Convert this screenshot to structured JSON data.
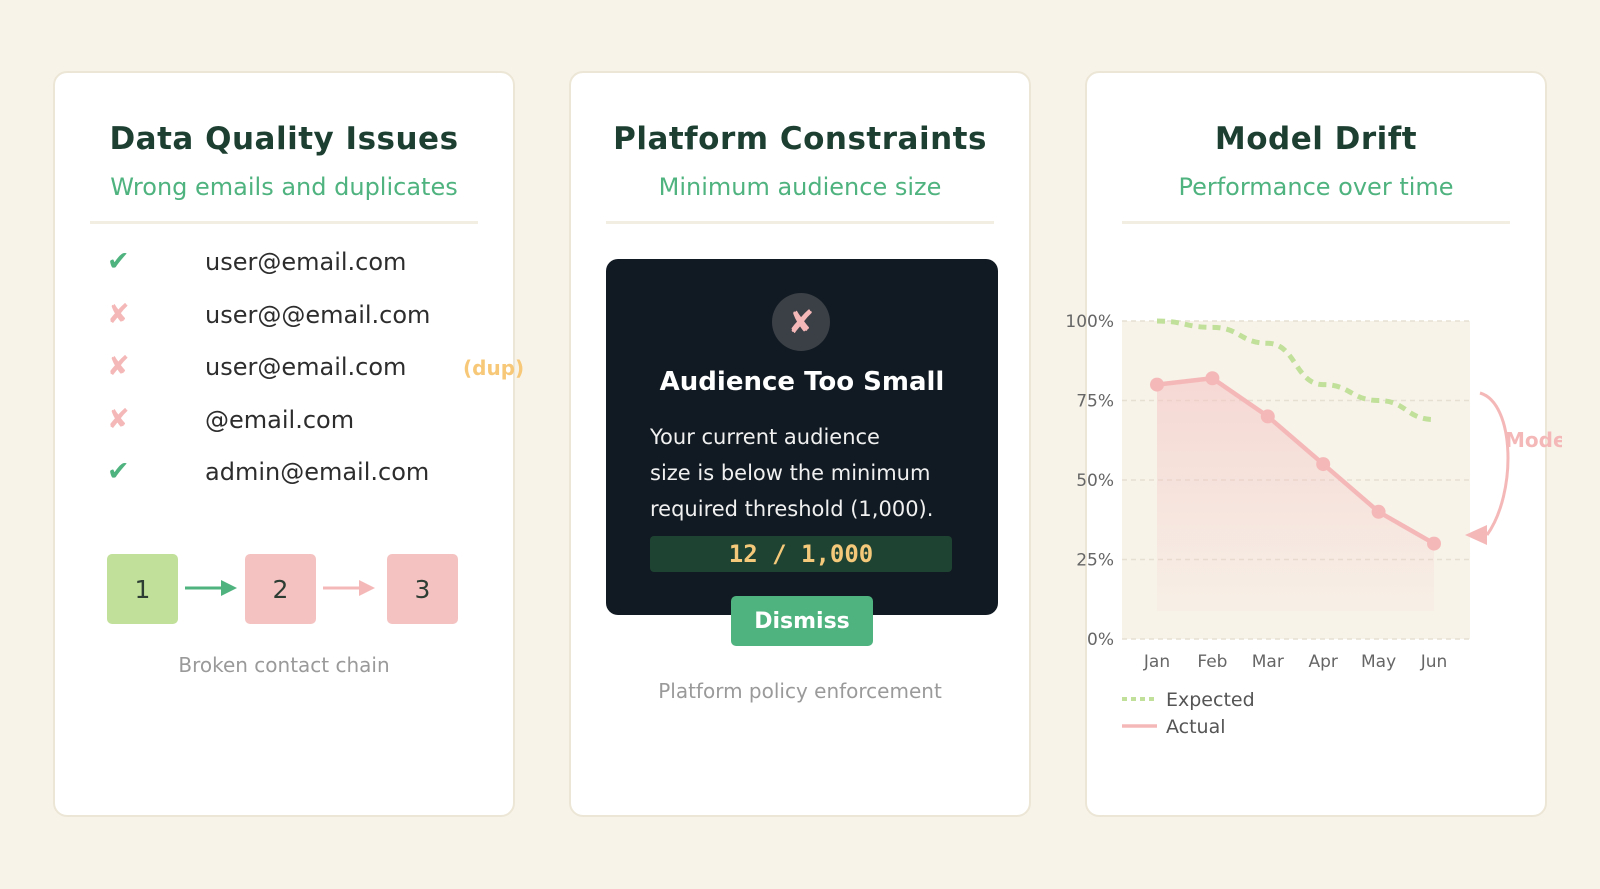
{
  "colors": {
    "background": "#f7f3e9",
    "title": "#1c3f32",
    "accent_green": "#4fb37f",
    "error_pink": "#f5b8b8",
    "light_green": "#c1e09a",
    "warning_amber": "#f7c878",
    "dialog_bg": "#111a22"
  },
  "data_quality": {
    "title": "Data Quality Issues",
    "subtitle": "Wrong emails and duplicates",
    "emails": [
      {
        "status_icon": "check-icon",
        "mark": "✔",
        "valid": true,
        "address": "user@email.com",
        "tag": ""
      },
      {
        "status_icon": "cross-icon",
        "mark": "✘",
        "valid": false,
        "address": "user@@email.com",
        "tag": ""
      },
      {
        "status_icon": "cross-icon",
        "mark": "✘",
        "valid": false,
        "address": "user@email.com",
        "tag": "(dup)"
      },
      {
        "status_icon": "cross-icon",
        "mark": "✘",
        "valid": false,
        "address": "@email.com",
        "tag": ""
      },
      {
        "status_icon": "check-icon",
        "mark": "✔",
        "valid": true,
        "address": "admin@email.com",
        "tag": ""
      }
    ],
    "chain": {
      "steps": [
        "1",
        "2",
        "3"
      ],
      "step_colors": [
        "#c1e09a",
        "#f5c2c2",
        "#f5c2c2"
      ],
      "caption": "Broken contact chain"
    }
  },
  "platform": {
    "title": "Platform Constraints",
    "subtitle": "Minimum audience size",
    "dialog": {
      "icon": "cross-icon",
      "icon_glyph": "✘",
      "title": "Audience Too Small",
      "body_lines": [
        "Your current audience",
        "size is below the minimum",
        "required threshold (1,000)."
      ],
      "count": "12 / 1,000"
    },
    "dismiss_label": "Dismiss",
    "caption": "Platform policy enforcement"
  },
  "drift": {
    "title": "Model Drift",
    "subtitle": "Performance over time",
    "annotation": "Model Drift",
    "chart_data": {
      "type": "line",
      "x": [
        "Jan",
        "Feb",
        "Mar",
        "Apr",
        "May",
        "Jun"
      ],
      "y_ticks": [
        "0%",
        "25%",
        "50%",
        "75%",
        "100%"
      ],
      "ylim": [
        0,
        100
      ],
      "grid": true,
      "legend_position": "bottom-left",
      "series": [
        {
          "name": "Expected",
          "style": "dashed",
          "color": "#c1e09a",
          "values": [
            100,
            98,
            93,
            80,
            75,
            69
          ]
        },
        {
          "name": "Actual",
          "style": "solid",
          "color": "#f5b8b8",
          "values": [
            80,
            82,
            70,
            55,
            40,
            30
          ]
        }
      ]
    }
  }
}
